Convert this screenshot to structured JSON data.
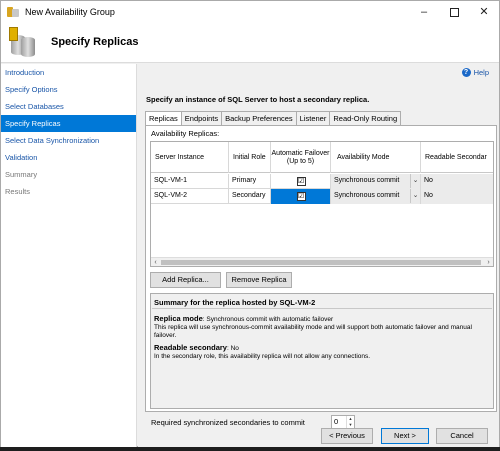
{
  "window": {
    "title": "New Availability Group",
    "minimize": "–",
    "close": "✕"
  },
  "header": {
    "title": "Specify Replicas"
  },
  "sidebar": {
    "items": [
      {
        "label": "Introduction",
        "state": "link"
      },
      {
        "label": "Specify Options",
        "state": "link"
      },
      {
        "label": "Select Databases",
        "state": "link"
      },
      {
        "label": "Specify Replicas",
        "state": "active"
      },
      {
        "label": "Select Data Synchronization",
        "state": "link"
      },
      {
        "label": "Validation",
        "state": "link"
      },
      {
        "label": "Summary",
        "state": "disabled"
      },
      {
        "label": "Results",
        "state": "disabled"
      }
    ]
  },
  "help": {
    "label": "Help"
  },
  "instruction": "Specify an instance of SQL Server to host a secondary replica.",
  "tabs": [
    {
      "label": "Replicas",
      "active": true
    },
    {
      "label": "Endpoints"
    },
    {
      "label": "Backup Preferences"
    },
    {
      "label": "Listener"
    },
    {
      "label": "Read-Only Routing"
    }
  ],
  "replicas": {
    "section_label": "Availability Replicas:",
    "columns": {
      "server_instance": "Server Instance",
      "initial_role": "Initial Role",
      "automatic_failover": "Automatic Failover (Up to 5)",
      "availability_mode": "Availability Mode",
      "readable_secondary": "Readable Secondar"
    },
    "rows": [
      {
        "server": "SQL-VM-1",
        "role": "Primary",
        "failover": "☑",
        "mode": "Synchronous commit",
        "readable": "No"
      },
      {
        "server": "SQL-VM-2",
        "role": "Secondary",
        "failover": "☑",
        "mode": "Synchronous commit",
        "readable": "No"
      }
    ],
    "dropdown_arrow": "⌄",
    "add_button": "Add Replica...",
    "remove_button": "Remove Replica"
  },
  "summary": {
    "title": "Summary for the replica hosted by SQL-VM-2",
    "mode_label": "Replica mode",
    "mode_value": ": Synchronous commit with automatic failover",
    "mode_desc": "This replica will use synchronous-commit availability mode and will support both automatic failover and manual failover.",
    "readable_label": "Readable secondary",
    "readable_value": ": No",
    "readable_desc": "In the secondary role, this availability replica will not allow any connections."
  },
  "required_sync": {
    "label": "Required synchronized secondaries to commit",
    "value": "0"
  },
  "footer": {
    "previous": "< Previous",
    "next": "Next >",
    "cancel": "Cancel"
  }
}
